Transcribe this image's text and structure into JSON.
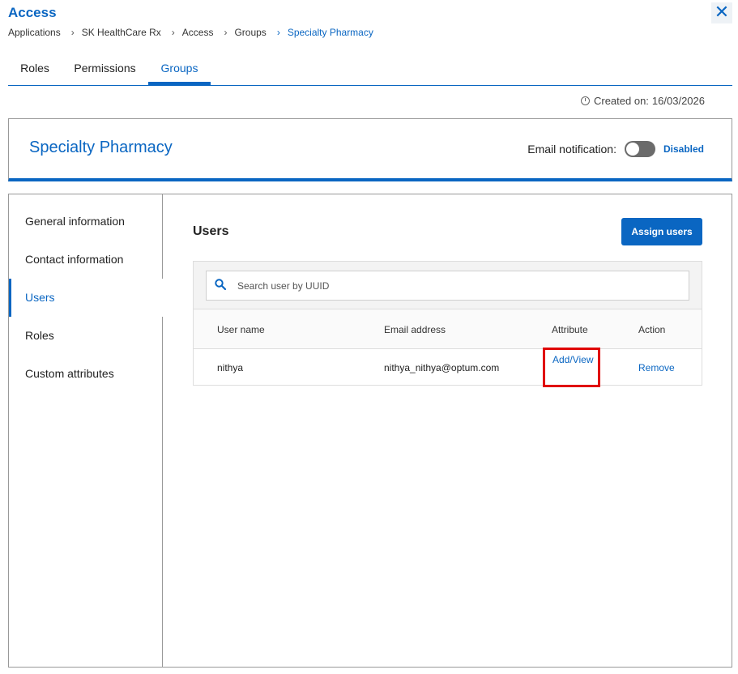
{
  "app": {
    "title": "Access",
    "close_icon": "close-icon"
  },
  "breadcrumb": [
    "Applications",
    "SK HealthCare Rx",
    "Access",
    "Groups",
    "Specialty Pharmacy"
  ],
  "tabs": [
    {
      "label": "Roles",
      "active": false
    },
    {
      "label": "Permissions",
      "active": false
    },
    {
      "label": "Groups",
      "active": true
    }
  ],
  "created": {
    "label": "Created on:",
    "date": "16/03/2026"
  },
  "group": {
    "title": "Specialty Pharmacy",
    "email_notification_label": "Email notification:",
    "email_notification_status": "Disabled",
    "email_notification_enabled": false
  },
  "side_nav": [
    {
      "label": "General information",
      "active": false
    },
    {
      "label": "Contact information",
      "active": false
    },
    {
      "label": "Users",
      "active": true
    },
    {
      "label": "Roles",
      "active": false
    },
    {
      "label": "Custom attributes",
      "active": false
    }
  ],
  "users": {
    "title": "Users",
    "assign_button": "Assign users",
    "search_placeholder": "Search user by UUID",
    "columns": [
      "User name",
      "Email address",
      "Attribute",
      "Action"
    ],
    "rows": [
      {
        "user_name": "nithya",
        "email": "nithya_nithya@optum.com",
        "attribute": "Add/View",
        "action": "Remove"
      }
    ]
  },
  "colors": {
    "accent": "#0a66c2",
    "highlight": "#e00000"
  }
}
